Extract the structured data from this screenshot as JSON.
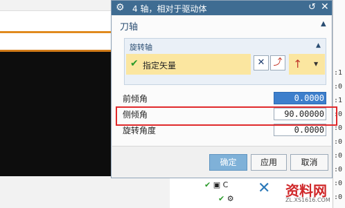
{
  "dialog": {
    "title": "4 轴，相对于驱动体",
    "gear_icon": "⚙",
    "reset_icon": "↺",
    "close_icon": "✕"
  },
  "tool_axis": {
    "title": "刀轴",
    "caret": "▲",
    "rotation_axis": {
      "title": "旋转轴",
      "caret": "▲",
      "check_icon": "✔",
      "vector_label": "指定矢量",
      "vector_dialog_icon": "✕",
      "inferred_vector_icon": "⤴",
      "vector_dropdown_icon": "↑",
      "dropdown_caret": "▼"
    },
    "lead_angle": {
      "label": "前倾角",
      "value": "0.0000"
    },
    "tilt_angle": {
      "label": "侧倾角",
      "value": "90.00000"
    },
    "rotation_angle": {
      "label": "旋转角度",
      "value": "0.0000"
    }
  },
  "buttons": {
    "ok": "确定",
    "apply": "应用",
    "cancel": "取消"
  },
  "background": {
    "right_values": [
      ":1",
      ":0",
      ":1",
      ":0",
      ":0",
      ":0",
      ":0",
      ":0",
      ":0",
      ":0",
      ":1"
    ],
    "tree_items": [
      {
        "check": "✔",
        "icon": "▣",
        "label": "C"
      },
      {
        "check": "✔",
        "icon": "⚙",
        "label": ""
      }
    ]
  },
  "watermark": {
    "logo": "✕",
    "text": "资料网",
    "url": "ZL.XS1616.COM"
  },
  "colors": {
    "titlebar": "#3f6c92",
    "highlight": "#e0282a",
    "selected_input": "#3d7fcc",
    "vector_row": "#fbe6a0"
  }
}
